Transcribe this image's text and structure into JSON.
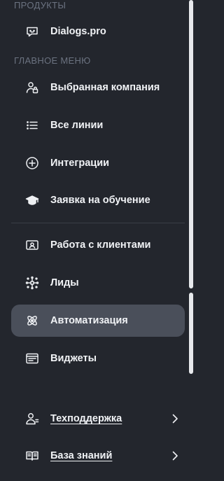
{
  "sections": {
    "products": "ПРОДУКТЫ",
    "main_menu": "ГЛАВНОЕ МЕНЮ"
  },
  "products": [
    {
      "label": "Dialogs.pro",
      "icon": "chat-bot-icon"
    }
  ],
  "menu": [
    {
      "label": "Выбранная компания",
      "icon": "user-lock-icon"
    },
    {
      "label": "Все линии",
      "icon": "list-icon"
    },
    {
      "label": "Интеграции",
      "icon": "plus-circle-icon"
    },
    {
      "label": "Заявка на обучение",
      "icon": "graduation-cap-icon"
    },
    {
      "label": "Работа с клиентами",
      "icon": "id-card-icon"
    },
    {
      "label": "Лиды",
      "icon": "network-icon"
    },
    {
      "label": "Автоматизация",
      "icon": "atom-icon",
      "active": true
    },
    {
      "label": "Виджеты",
      "icon": "widget-window-icon"
    }
  ],
  "footer": [
    {
      "label": "Техподдержка",
      "icon": "support-user-icon"
    },
    {
      "label": "База знаний",
      "icon": "book-icon"
    }
  ],
  "colors": {
    "background": "#23262d",
    "active_item": "#4a4f5a",
    "section_title": "#6b7280",
    "text": "#f1f3f6"
  }
}
